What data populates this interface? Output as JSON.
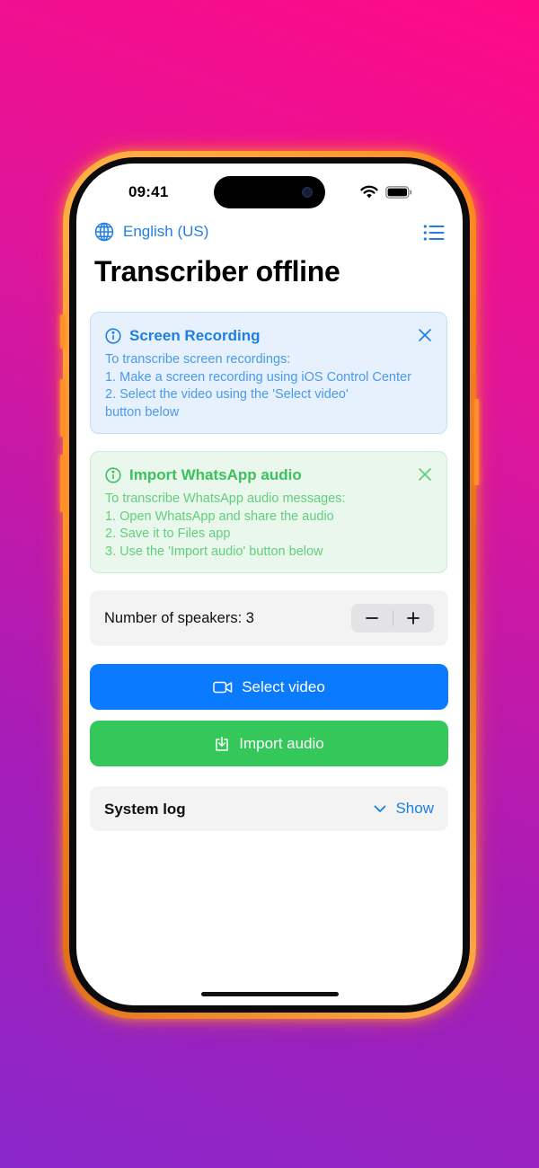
{
  "status_bar": {
    "time": "09:41"
  },
  "header": {
    "language": "English (US)",
    "title": "Transcriber offline"
  },
  "cards": {
    "screen_recording": {
      "title": "Screen Recording",
      "lines": [
        "To transcribe screen recordings:",
        "1. Make a screen recording using iOS Control Center",
        "2. Select the video using the 'Select video'",
        "button below"
      ]
    },
    "whatsapp": {
      "title": "Import WhatsApp audio",
      "lines": [
        "To transcribe WhatsApp audio messages:",
        "1. Open WhatsApp and share the audio",
        "2. Save it to Files app",
        "3. Use the 'Import audio' button below"
      ]
    }
  },
  "speakers": {
    "label": "Number of speakers: 3",
    "minus": "−",
    "plus": "+"
  },
  "buttons": {
    "select_video": "Select video",
    "import_audio": "Import audio"
  },
  "system_log": {
    "label": "System log",
    "toggle": "Show"
  },
  "icons": [
    "globe-icon",
    "list-icon",
    "info-icon",
    "close-icon",
    "video-camera-icon",
    "import-icon",
    "chevron-down-icon",
    "wifi-icon",
    "battery-icon"
  ],
  "colors": {
    "accent_blue": "#0a7aff",
    "accent_green": "#34c759",
    "info_blue_bg": "#e6f1fd",
    "info_green_bg": "#e9f7ec",
    "phone_frame": "#ff8a1f"
  }
}
